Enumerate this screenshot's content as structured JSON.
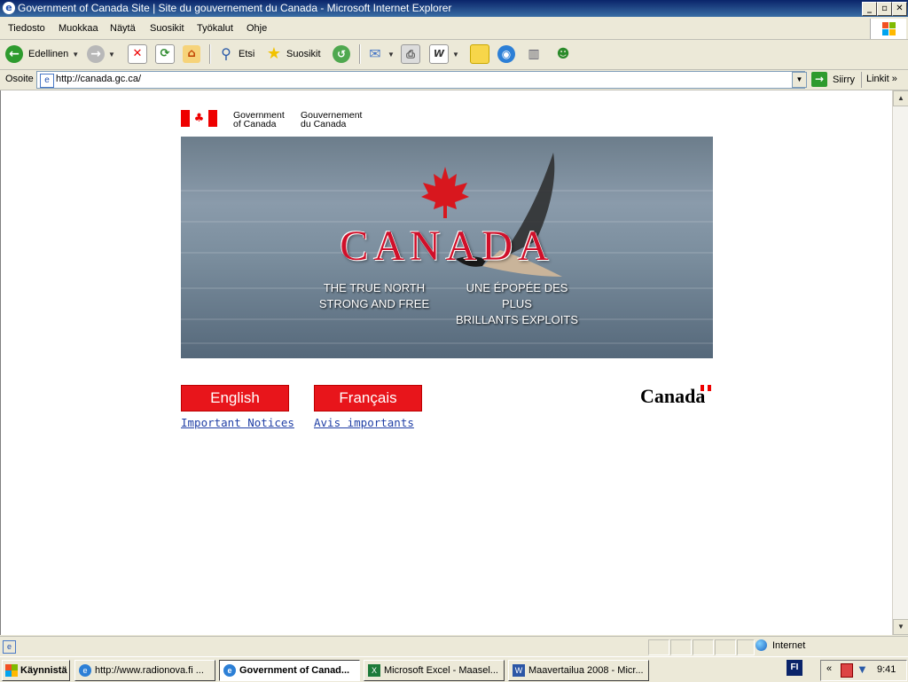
{
  "window": {
    "title": "Government of Canada Site | Site du gouvernement du Canada - Microsoft Internet Explorer",
    "buttons": [
      "_",
      "▫",
      "✕"
    ]
  },
  "menu": [
    "Tiedosto",
    "Muokkaa",
    "Näytä",
    "Suosikit",
    "Työkalut",
    "Ohje"
  ],
  "toolbar": {
    "back_label": "Edellinen",
    "search_label": "Etsi",
    "favorites_label": "Suosikit"
  },
  "address": {
    "label": "Osoite",
    "url": "http://canada.gc.ca/",
    "go_label": "Siirry",
    "links_label": "Linkit"
  },
  "page": {
    "gov_en_line1": "Government",
    "gov_en_line2": "of Canada",
    "gov_fr_line1": "Gouvernement",
    "gov_fr_line2": "du Canada",
    "banner_title": "CANADA",
    "banner_en_line1": "THE TRUE NORTH",
    "banner_en_line2": "STRONG AND FREE",
    "banner_fr_line1": "UNE ÉPOPÉE DES PLUS",
    "banner_fr_line2": "BRILLANTS EXPLOITS",
    "english_button": "English",
    "french_button": "Français",
    "notices_en": "Important Notices",
    "notices_fr": "Avis importants",
    "wordmark": "Canada"
  },
  "status": {
    "zone": "Internet"
  },
  "taskbar": {
    "start_label": "Käynnistä",
    "tasks": [
      {
        "label": "http://www.radionova.fi ...",
        "icon": "ie-icon"
      },
      {
        "label": "Government of Canad...",
        "icon": "ie-icon"
      },
      {
        "label": "Microsoft Excel - Maasel...",
        "icon": "excel-icon"
      },
      {
        "label": "Maavertailua 2008 - Micr...",
        "icon": "word-icon"
      }
    ],
    "lang": "FI",
    "clock": "9:41"
  },
  "colors": {
    "canada_red": "#e8151b",
    "link_blue": "#2140a6",
    "xp_title_blue": "#0a246a"
  }
}
